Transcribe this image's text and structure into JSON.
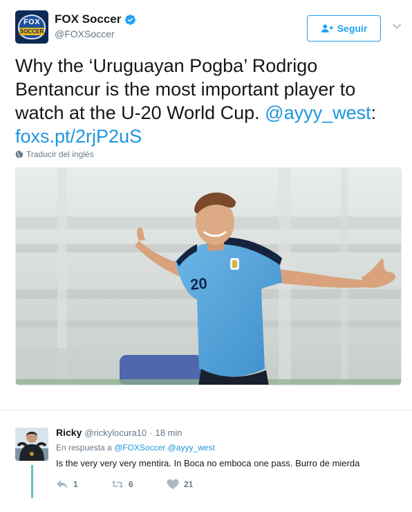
{
  "account": {
    "avatar_text_top": "FOX",
    "avatar_text_bottom": "SOCCER",
    "display_name": "FOX Soccer",
    "handle": "@FOXSoccer",
    "verified_icon": "verified-badge-icon"
  },
  "follow_button": {
    "label": "Seguir",
    "icon": "add-user-icon"
  },
  "more_icon": "chevron-down-icon",
  "tweet": {
    "text": "Why the ‘Uruguayan Pogba’ Rodrigo Bentancur is the most important player to watch at the U-20 World Cup. ",
    "mention": "@ayyy_west",
    "colon": ":",
    "link": "foxs.pt/2rjP2uS",
    "translate_label": "Traducir del inglés",
    "translate_icon": "globe-icon"
  },
  "photo": {
    "jersey_number": "20"
  },
  "reply": {
    "name": "Ricky",
    "handle": "@rickylocura10",
    "separator": "·",
    "time": "18 min",
    "reply_to_prefix": "En respuesta a ",
    "reply_to_user1": "@FOXSoccer",
    "reply_to_user2": "@ayyy_west",
    "text": "Is the very very very mentira. In Boca no emboca one pass. Burro de mierda",
    "actions": {
      "reply_count": "1",
      "retweet_count": "6",
      "like_count": "21"
    }
  },
  "colors": {
    "link_blue": "#1b95e0",
    "follow_blue": "#1da1f2",
    "thread_line": "#5fc3c5",
    "secondary_text": "#657786"
  }
}
